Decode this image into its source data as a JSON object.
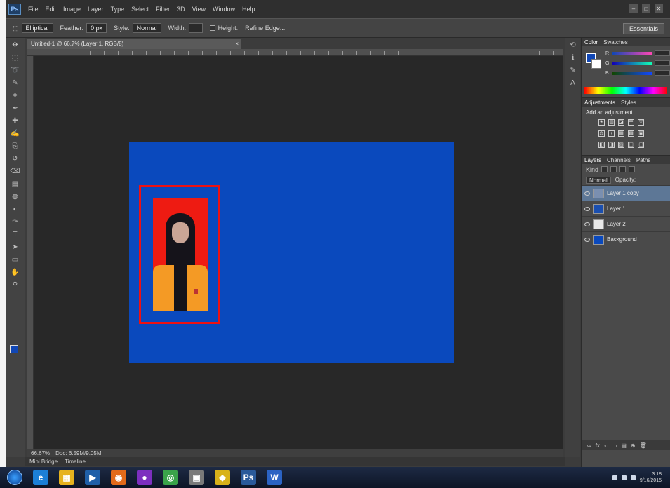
{
  "app": {
    "logo": "Ps",
    "menu": [
      "File",
      "Edit",
      "Image",
      "Layer",
      "Type",
      "Select",
      "Filter",
      "3D",
      "View",
      "Window",
      "Help"
    ],
    "window_controls": [
      "–",
      "□",
      "✕"
    ]
  },
  "options_bar": {
    "tool_preset": "Elliptical",
    "feather_label": "Feather:",
    "feather_value": "0 px",
    "style_label": "Style:",
    "style_value": "Normal",
    "width_label": "Width:",
    "height_label": "Height:",
    "refine_edge": "Refine Edge...",
    "workspace": "Essentials"
  },
  "document": {
    "tab_title": "Untitled-1 @ 66.7% (Layer 1, RGB/8)",
    "tab_close": "×",
    "zoom": "66.67%",
    "doc_info": "Doc: 6.59M/9.05M",
    "background_color": "#0a49bd",
    "photo_background_color": "#ee1b12",
    "highlight_color": "#ee1111",
    "bottom_tabs": [
      "Mini Bridge",
      "Timeline"
    ]
  },
  "toolbar": {
    "tools": [
      "move-icon",
      "marquee-icon",
      "lasso-icon",
      "quick-select-icon",
      "crop-icon",
      "eyedropper-icon",
      "healing-icon",
      "brush-icon",
      "clone-stamp-icon",
      "history-brush-icon",
      "eraser-icon",
      "gradient-icon",
      "blur-icon",
      "dodge-icon",
      "pen-icon",
      "type-icon",
      "path-select-icon",
      "rectangle-icon",
      "hand-icon",
      "zoom-icon"
    ],
    "glyphs": [
      "✥",
      "⬚",
      "➰",
      "✎",
      "⌗",
      "✒",
      "✚",
      "✍",
      "⎘",
      "↺",
      "⌫",
      "▤",
      "◍",
      "◐",
      "✑",
      "T",
      "➤",
      "▭",
      "✋",
      "⚲"
    ],
    "foreground_color": "#1147b5",
    "background_color": "#ffffff"
  },
  "panels": {
    "color": {
      "tabs": [
        "Color",
        "Swatches"
      ],
      "channels": [
        "R",
        "G",
        "B"
      ],
      "foreground_color": "#1147b5"
    },
    "adjustments": {
      "tabs": [
        "Adjustments",
        "Styles"
      ],
      "title": "Add an adjustment",
      "row1": [
        "☀",
        "▥",
        "◪",
        "☰",
        "▽"
      ],
      "row2": [
        "⚖",
        "◑",
        "▦",
        "▩",
        "▣"
      ],
      "row3": [
        "◧",
        "◨",
        "▨",
        "◫",
        "▢"
      ]
    },
    "layers": {
      "tabs": [
        "Layers",
        "Channels",
        "Paths"
      ],
      "kind_label": "Kind",
      "blend_mode": "Normal",
      "opacity_label": "Opacity:",
      "layers": [
        {
          "name": "Layer 1 copy",
          "selected": true,
          "thumb_color": "#7a8fb0"
        },
        {
          "name": "Layer 1",
          "selected": false,
          "thumb_color": "#1a4fb0"
        },
        {
          "name": "Layer 2",
          "selected": false,
          "thumb_color": "#e9e9e9"
        },
        {
          "name": "Background",
          "selected": false,
          "thumb_color": "#0a49bd"
        }
      ],
      "footer_icons": [
        "∞",
        "fx",
        "◐",
        "▭",
        "▤",
        "⊕",
        "🗑"
      ]
    }
  },
  "taskbar": {
    "apps": [
      {
        "name": "ie-icon",
        "glyph": "e",
        "color": "#1c7fd6"
      },
      {
        "name": "explorer-icon",
        "glyph": "▦",
        "color": "#e6b21e"
      },
      {
        "name": "media-icon",
        "glyph": "▶",
        "color": "#1f5fa8"
      },
      {
        "name": "firefox-icon",
        "glyph": "◉",
        "color": "#e26a1a"
      },
      {
        "name": "app-purple-icon",
        "glyph": "●",
        "color": "#7d2fbf"
      },
      {
        "name": "chrome-icon",
        "glyph": "◎",
        "color": "#3aa34a"
      },
      {
        "name": "app-box-icon",
        "glyph": "▣",
        "color": "#7a7a7a"
      },
      {
        "name": "app-yellow-icon",
        "glyph": "◆",
        "color": "#d8b21a"
      },
      {
        "name": "photoshop-icon",
        "glyph": "Ps",
        "color": "#2a5a9a"
      },
      {
        "name": "word-icon",
        "glyph": "W",
        "color": "#2b63c4"
      }
    ],
    "clock_time": "3:18",
    "clock_date": "9/16/2015"
  }
}
